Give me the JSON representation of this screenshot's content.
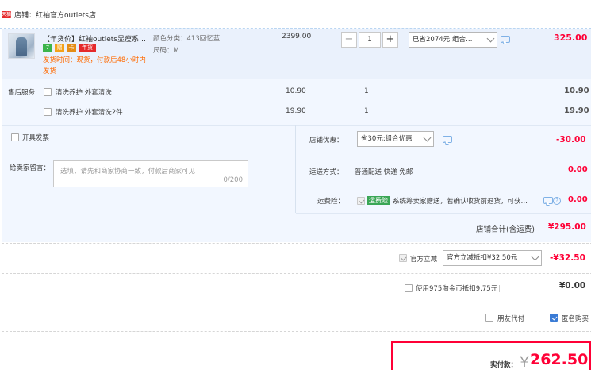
{
  "shop": {
    "icon_label": "天猫",
    "name": "店铺：红袖官方outlets店"
  },
  "item": {
    "title": "【年货价】红袖outlets显瘦系…",
    "badges": [
      "7",
      "赠",
      "卡",
      "年货"
    ],
    "shipping": "发货时间：现货，付款后48小时内发货",
    "color_label": "颜色分类：",
    "color_value": "413回忆蓝",
    "size_label": "尺码：",
    "size_value": "M",
    "unit_price": "2399.00",
    "quantity_minus": "−",
    "quantity": "1",
    "quantity_plus": "+",
    "discount_select": "已省2074元:组合…",
    "subtotal": "325.00"
  },
  "after_sales": {
    "label": "售后服务",
    "services": [
      {
        "name": "清洗养护 外套清洗",
        "price": "10.90",
        "qty": "1",
        "total": "10.90"
      },
      {
        "name": "清洗养护 外套清洗2件",
        "price": "19.90",
        "qty": "1",
        "total": "19.90"
      }
    ]
  },
  "invoice": {
    "label": "开具发票"
  },
  "message": {
    "label": "给卖家留言：",
    "placeholder": "选填，请先和商家协商一致，付款后商家可见",
    "counter": "0/200"
  },
  "shop_discount": {
    "label": "店铺优惠：",
    "select": "省30元:组合优惠",
    "amount": "-30.00"
  },
  "delivery": {
    "label": "运送方式：",
    "value": "普通配送 快递 免邮",
    "amount": "0.00"
  },
  "shipping_insurance": {
    "label": "运费险：",
    "badge": "运费险",
    "text": "系统筹卖家赠送，若确认收货前退货，可获…",
    "help": "?",
    "amount": "0.00"
  },
  "shop_total": {
    "label": "店铺合计(含运费)",
    "amount": "¥295.00"
  },
  "official_discount": {
    "label": "官方立减",
    "select": "官方立减抵扣¥32.50元",
    "amount": "-¥32.50"
  },
  "coins": {
    "label": "使用975淘金币抵扣9.75元",
    "amount": "¥0.00"
  },
  "options": {
    "friend_pay": "朋友代付",
    "anonymous": "匿名购买"
  },
  "payment": {
    "label": "实付款：",
    "currency": "￥",
    "amount": "262.50"
  },
  "colors": {
    "accent_red": "#ff0036",
    "blue_bg": "#f2f7ff",
    "check_blue": "#3a7bd5"
  }
}
